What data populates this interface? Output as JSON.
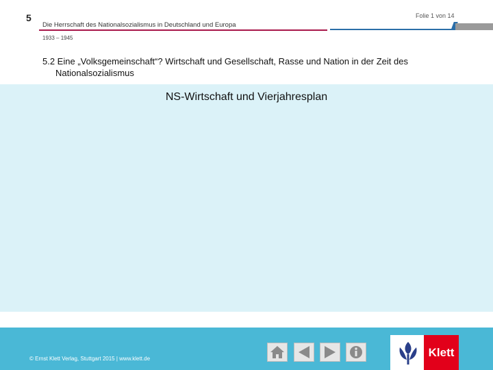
{
  "header": {
    "chapter_number": "5",
    "slide_counter": "Folie 1 von 14",
    "title": "Die Herrschaft des Nationalsozialismus in Deutschland und Europa",
    "years": "1933 – 1945"
  },
  "section": {
    "heading_line1": "5.2 Eine „Volksgemeinschaft“? Wirtschaft und Gesellschaft, Rasse und Nation in der Zeit des",
    "heading_line2": "Nationalsozialismus"
  },
  "content": {
    "title": "NS-Wirtschaft und Vierjahresplan"
  },
  "footer": {
    "copyright": "© Ernst Klett Verlag, Stuttgart 2015 | www.klett.de",
    "nav": [
      {
        "icon": "home-icon"
      },
      {
        "icon": "previous-icon"
      },
      {
        "icon": "next-icon"
      },
      {
        "icon": "info-icon"
      }
    ],
    "logo_text": "Klett"
  },
  "colors": {
    "accent": "#a8164a",
    "content_bg": "#dbf2f8",
    "footer_bg": "#4ab8d6",
    "logo_red": "#e2001a",
    "line_blue": "#2a6ea8"
  }
}
